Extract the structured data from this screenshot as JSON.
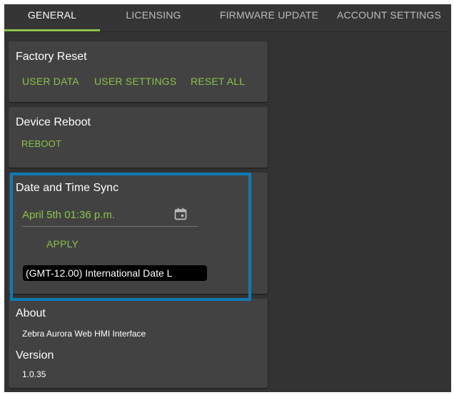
{
  "tabs": [
    "GENERAL",
    "LICENSING",
    "FIRMWARE UPDATE",
    "ACCOUNT SETTINGS"
  ],
  "factory_reset": {
    "title": "Factory Reset",
    "buttons": [
      "USER DATA",
      "USER SETTINGS",
      "RESET ALL"
    ]
  },
  "device_reboot": {
    "title": "Device Reboot",
    "button": "REBOOT"
  },
  "date_time_sync": {
    "title": "Date and Time Sync",
    "date_value": "April 5th 01:36 p.m.",
    "apply_label": "APPLY",
    "timezone_value": "(GMT-12.00) International Date L"
  },
  "about": {
    "title": "About",
    "product": "Zebra Aurora Web HMI Interface",
    "version_title": "Version",
    "version": "1.0.35"
  },
  "colors": {
    "accent": "#8bc34a",
    "highlight": "#0f7ab3",
    "card": "#424242",
    "background": "#333333"
  },
  "icons": {
    "calendar": "calendar-icon"
  }
}
